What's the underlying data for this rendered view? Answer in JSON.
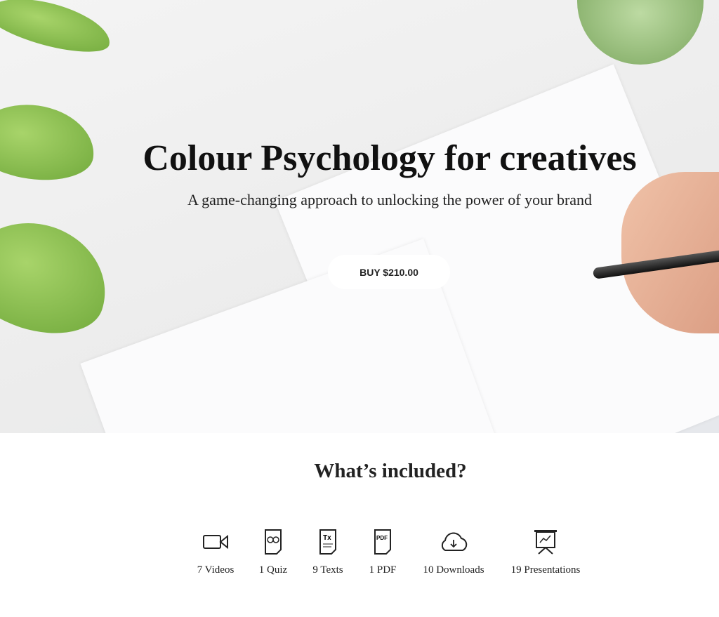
{
  "hero": {
    "title": "Colour Psychology for creatives",
    "subtitle": "A game-changing approach to unlocking the power of your brand",
    "buy_label": "BUY $210.00"
  },
  "included": {
    "heading": "What’s included?",
    "items": [
      {
        "icon": "video-icon",
        "label": "7 Videos"
      },
      {
        "icon": "quiz-icon",
        "label": "1 Quiz"
      },
      {
        "icon": "text-document-icon",
        "label": "9 Texts"
      },
      {
        "icon": "pdf-icon",
        "label": "1 PDF"
      },
      {
        "icon": "cloud-download-icon",
        "label": "10 Downloads"
      },
      {
        "icon": "presentation-icon",
        "label": "19 Presentations"
      }
    ]
  }
}
